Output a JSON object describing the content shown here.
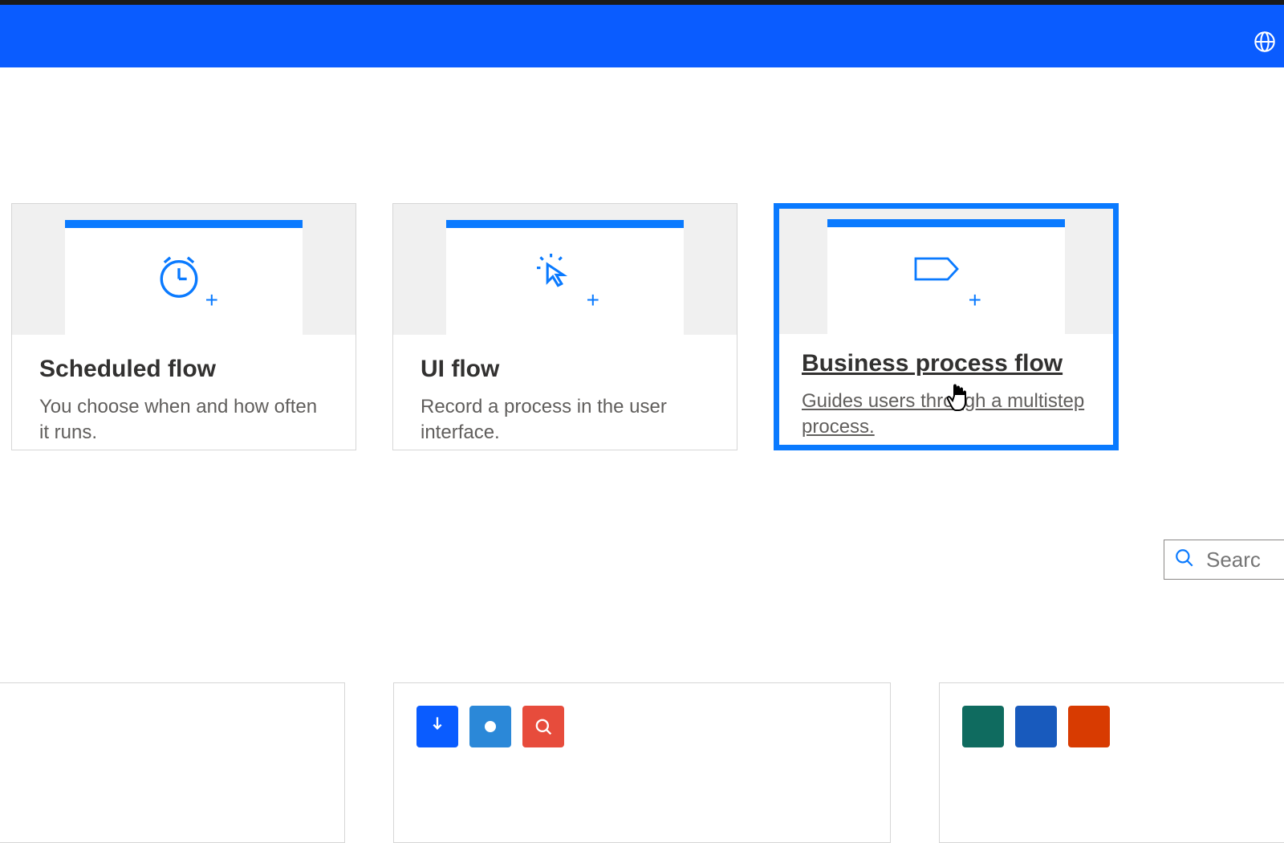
{
  "header": {
    "globe_icon": "globe-icon"
  },
  "cards": [
    {
      "title": "Scheduled flow",
      "description": "You choose when and how often it runs.",
      "icon": "clock"
    },
    {
      "title": "UI flow",
      "description": "Record a process in the user interface.",
      "icon": "cursor"
    },
    {
      "title": "Business process flow",
      "description": "Guides users through a multistep process.",
      "icon": "stage",
      "selected": true
    }
  ],
  "search": {
    "placeholder": "Searc"
  },
  "colors": {
    "primary": "#0a5cff",
    "accent": "#0a7aff",
    "red": "#e74c3c",
    "teal": "#0f6b5f",
    "orange": "#d83b01"
  }
}
